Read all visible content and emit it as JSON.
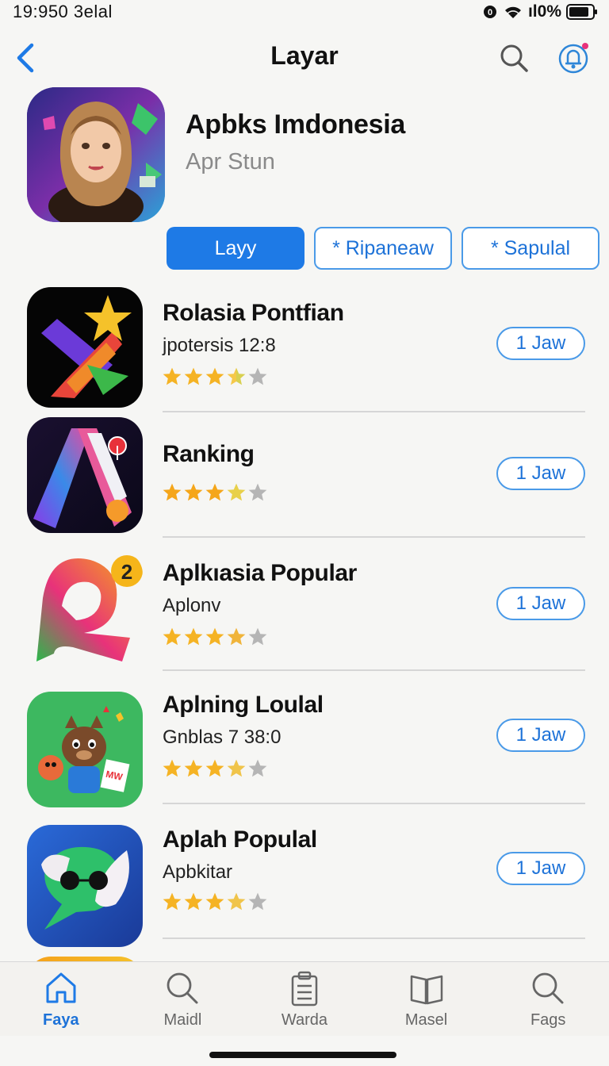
{
  "status_bar": {
    "time": "19:950 3elal",
    "battery": "ıl0%"
  },
  "header": {
    "title": "Layar"
  },
  "featured": {
    "title": "Apbks Imdonesia",
    "subtitle": "Apr Stun"
  },
  "tabs": [
    {
      "label": "Layy"
    },
    {
      "label": "* Ripaneaw"
    },
    {
      "label": "* Sapulal"
    }
  ],
  "apps": [
    {
      "name": "Rolasia Pontfian",
      "subtitle": "jpotersis 12:8",
      "rating": 3.5,
      "button": "1 Jaw"
    },
    {
      "name": "Ranking",
      "subtitle": "",
      "rating": 3.5,
      "button": "1 Jaw"
    },
    {
      "name": "Aplkıasia Popular",
      "subtitle": "Aplonv",
      "rating": 3.5,
      "button": "1 Jaw"
    },
    {
      "name": "Aplning Loulal",
      "subtitle": "Gnblas 7 38:0",
      "rating": 3.5,
      "button": "1 Jaw"
    },
    {
      "name": "Aplah Populal",
      "subtitle": "Apbkitar",
      "rating": 3.5,
      "button": "1 Jaw"
    }
  ],
  "tab_bar": [
    {
      "label": "Faya",
      "icon": "home-icon"
    },
    {
      "label": "Maidl",
      "icon": "search-icon"
    },
    {
      "label": "Warda",
      "icon": "clipboard-icon"
    },
    {
      "label": "Masel",
      "icon": "book-icon"
    },
    {
      "label": "Fags",
      "icon": "search-icon"
    }
  ],
  "colors": {
    "accent": "#1e7ae6",
    "star": "#f5b324",
    "star_empty": "#b5b5b5"
  }
}
